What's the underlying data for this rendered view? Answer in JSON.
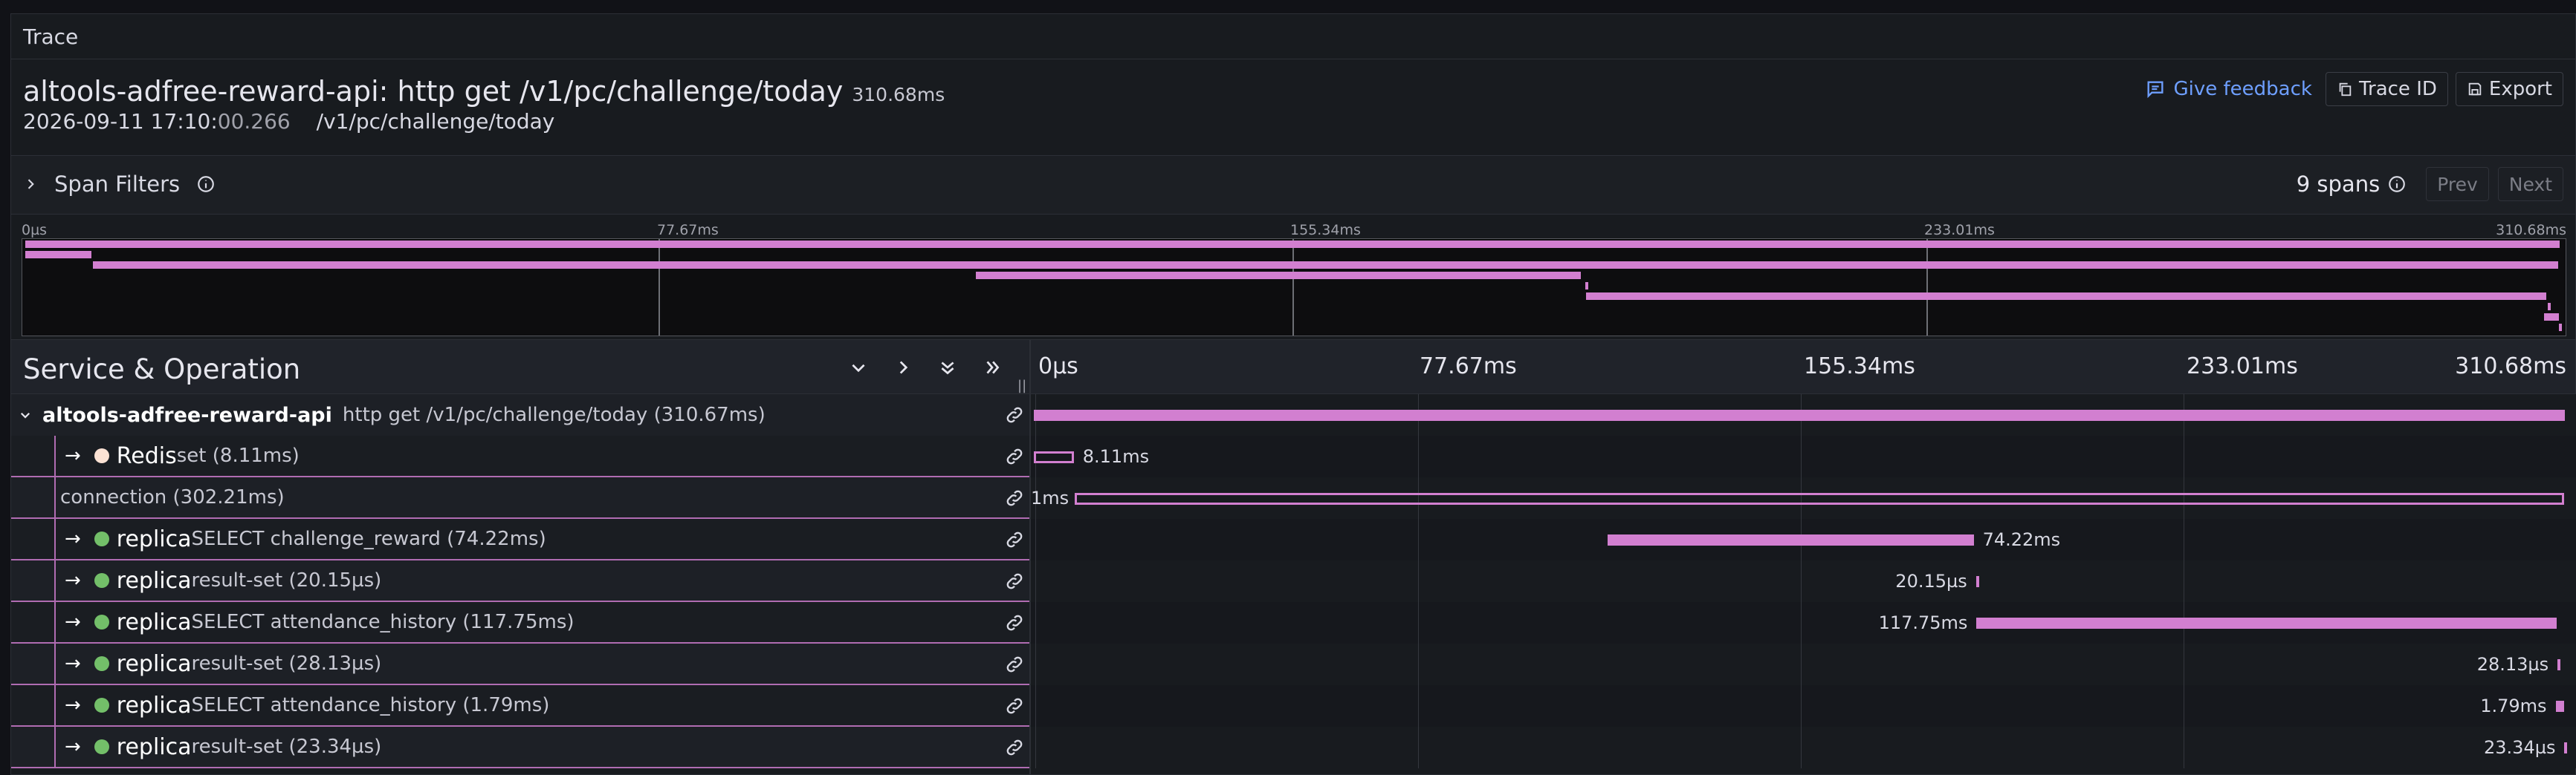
{
  "panel": {
    "title": "Trace"
  },
  "trace": {
    "name": "altools-adfree-reward-api: http get /v1/pc/challenge/today",
    "duration": "310.68ms",
    "date_main": "2026-09-11 17:10:",
    "date_ms": "00.266",
    "url": "/v1/pc/challenge/today"
  },
  "actions": {
    "feedback": "Give feedback",
    "trace_id": "Trace ID",
    "export": "Export"
  },
  "span_filters": {
    "label": "Span Filters",
    "spans_count": "9 spans",
    "prev": "Prev",
    "next": "Next"
  },
  "minimap": {
    "ticks": [
      "0µs",
      "77.67ms",
      "155.34ms",
      "233.01ms",
      "310.68ms"
    ]
  },
  "table": {
    "title": "Service & Operation",
    "ticks": [
      "0µs",
      "77.67ms",
      "155.34ms",
      "233.01ms",
      "310.68ms"
    ],
    "total_ms": 310.68,
    "rows": [
      {
        "service": "altools-adfree-reward-api",
        "operation": "http get /v1/pc/challenge/today (310.67ms)",
        "start_ms": 0,
        "dur_ms": 310.67,
        "label": "",
        "dot": "",
        "level": 0
      },
      {
        "service": "Redis",
        "operation": "set (8.11ms)",
        "start_ms": 0,
        "dur_ms": 8.11,
        "label": "8.11ms",
        "dot": "#fce2d4",
        "level": 1
      },
      {
        "service": "",
        "operation": "connection (302.21ms)",
        "start_ms": 8.3,
        "dur_ms": 302.21,
        "label": "1ms",
        "dot": "",
        "level": 1
      },
      {
        "service": "replica",
        "operation": "SELECT challenge_reward (74.22ms)",
        "start_ms": 116.5,
        "dur_ms": 74.22,
        "label": "74.22ms",
        "dot": "#73bf69",
        "level": 1
      },
      {
        "service": "replica",
        "operation": "result-set (20.15µs)",
        "start_ms": 191.2,
        "dur_ms": 0.02,
        "label": "20.15µs",
        "dot": "#73bf69",
        "level": 1
      },
      {
        "service": "replica",
        "operation": "SELECT attendance_history (117.75ms)",
        "start_ms": 191.3,
        "dur_ms": 117.75,
        "label": "117.75ms",
        "dot": "#73bf69",
        "level": 1
      },
      {
        "service": "replica",
        "operation": "result-set (28.13µs)",
        "start_ms": 309.2,
        "dur_ms": 0.03,
        "label": "28.13µs",
        "dot": "#73bf69",
        "level": 1
      },
      {
        "service": "replica",
        "operation": "SELECT attendance_history (1.79ms)",
        "start_ms": 308.8,
        "dur_ms": 1.79,
        "label": "1.79ms",
        "dot": "#73bf69",
        "level": 1
      },
      {
        "service": "replica",
        "operation": "result-set (23.34µs)",
        "start_ms": 310.6,
        "dur_ms": 0.02,
        "label": "23.34µs",
        "dot": "#73bf69",
        "level": 1
      }
    ]
  }
}
